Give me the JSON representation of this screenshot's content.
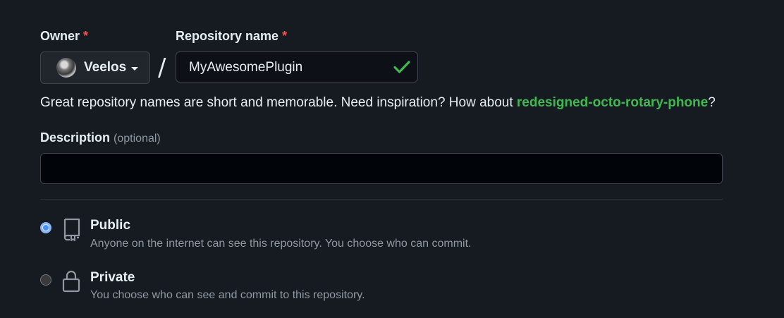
{
  "owner": {
    "label": "Owner",
    "required_mark": "*",
    "name": "Veelos"
  },
  "repository": {
    "label": "Repository name",
    "required_mark": "*",
    "value": "MyAwesomePlugin",
    "separator": "/"
  },
  "hint": {
    "prefix": "Great repository names are short and memorable. Need inspiration? How about ",
    "suggestion": "redesigned-octo-rotary-phone",
    "suffix": "?"
  },
  "description": {
    "label": "Description",
    "optional_text": "(optional)",
    "value": ""
  },
  "visibility": {
    "options": [
      {
        "title": "Public",
        "description": "Anyone on the internet can see this repository. You choose who can commit.",
        "icon": "repo-icon",
        "selected": true
      },
      {
        "title": "Private",
        "description": "You choose who can see and commit to this repository.",
        "icon": "lock-icon",
        "selected": false
      }
    ]
  },
  "colors": {
    "background": "#161b22",
    "required": "#f85149",
    "success": "#3fb950",
    "selected_radio": "#4493f8"
  }
}
